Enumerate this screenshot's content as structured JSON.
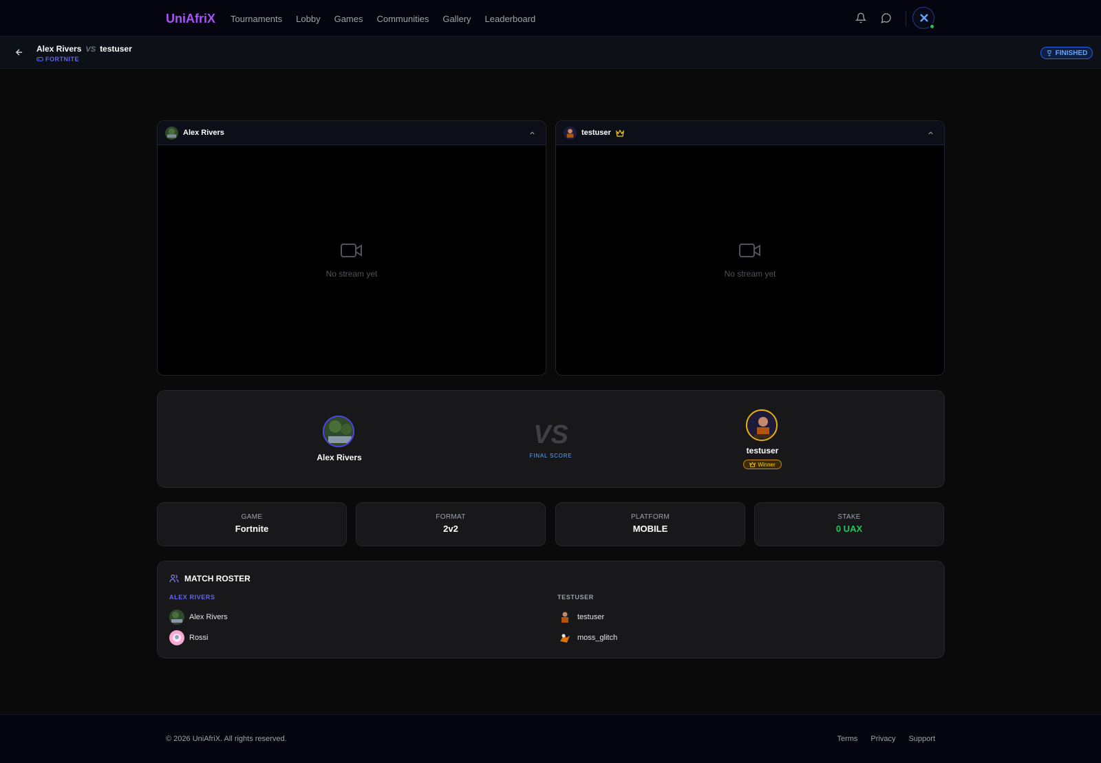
{
  "nav": {
    "brand": "UniAfriX",
    "links": [
      "Tournaments",
      "Lobby",
      "Games",
      "Communities",
      "Gallery",
      "Leaderboard"
    ],
    "online_color": "#22c55e"
  },
  "match": {
    "player_one": "Alex Rivers",
    "vs": "VS",
    "player_two": "testuser",
    "game_tag": "FORTNITE",
    "status": "FINISHED"
  },
  "streams": [
    {
      "player": "Alex Rivers",
      "winner": false,
      "empty_text": "No stream yet"
    },
    {
      "player": "testuser",
      "winner": true,
      "empty_text": "No stream yet"
    }
  ],
  "score": {
    "player_one": "Alex Rivers",
    "player_two": "testuser",
    "vs": "VS",
    "label": "FINAL SCORE",
    "winner_label": "Winner"
  },
  "info": [
    {
      "label": "GAME",
      "value": "Fortnite"
    },
    {
      "label": "FORMAT",
      "value": "2v2"
    },
    {
      "label": "PLATFORM",
      "value": "MOBILE"
    },
    {
      "label": "STAKE",
      "value": "0 UAX"
    }
  ],
  "roster": {
    "title": "MATCH ROSTER",
    "teams": [
      {
        "name": "ALEX RIVERS",
        "color": "#6366f1",
        "members": [
          "Alex Rivers",
          "Rossi"
        ]
      },
      {
        "name": "TESTUSER",
        "color": "#9ca3af",
        "members": [
          "testuser",
          "moss_glitch"
        ]
      }
    ]
  },
  "footer": {
    "copyright": "© 2026 UniAfriX. All rights reserved.",
    "links": [
      "Terms",
      "Privacy",
      "Support"
    ]
  }
}
